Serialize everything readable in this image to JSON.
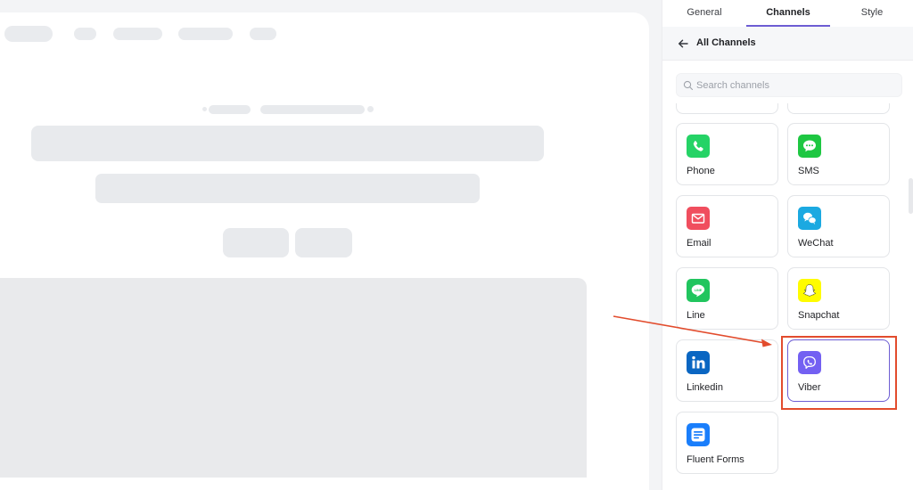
{
  "tabs": [
    {
      "label": "General"
    },
    {
      "label": "Channels"
    },
    {
      "label": "Style"
    }
  ],
  "active_tab": "Channels",
  "header": {
    "title": "All Channels"
  },
  "search": {
    "placeholder": "Search channels",
    "value": ""
  },
  "channels": [
    {
      "label": "Phone",
      "icon": "phone-icon",
      "color": "#25d366"
    },
    {
      "label": "SMS",
      "icon": "sms-icon",
      "color": "#1ec742"
    },
    {
      "label": "Email",
      "icon": "email-icon",
      "color": "#f04e5e"
    },
    {
      "label": "WeChat",
      "icon": "wechat-icon",
      "color": "#1ba9e1"
    },
    {
      "label": "Line",
      "icon": "line-icon",
      "color": "#21c55e"
    },
    {
      "label": "Snapchat",
      "icon": "snapchat-icon",
      "color": "#fffc00"
    },
    {
      "label": "Linkedin",
      "icon": "linkedin-icon",
      "color": "#0a66c2"
    },
    {
      "label": "Viber",
      "icon": "viber-icon",
      "color": "#7360f2",
      "selected": true
    },
    {
      "label": "Fluent Forms",
      "icon": "fluent-forms-icon",
      "color": "#1a7efb"
    }
  ],
  "colors": {
    "accent": "#6d5dd3",
    "annotation": "#e24c2d"
  }
}
